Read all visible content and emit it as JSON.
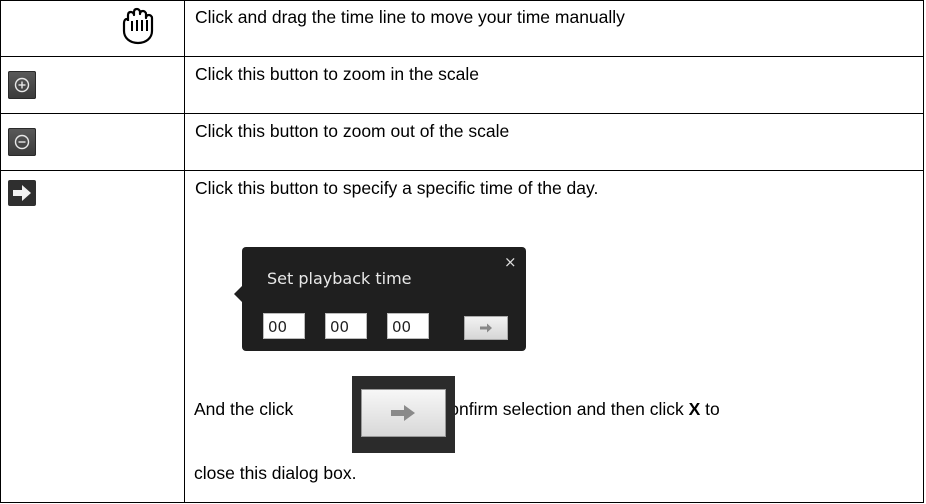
{
  "rows": [
    {
      "icon": "hand-grab-icon",
      "description": "Click and drag the time line to move your time manually"
    },
    {
      "icon": "zoom-in-icon",
      "description": "Click this button to zoom in the scale"
    },
    {
      "icon": "zoom-out-icon",
      "description": "Click this button to zoom out of the scale"
    },
    {
      "icon": "arrow-right-icon",
      "description": "Click this button to specify a specific time of the day.",
      "dialog": {
        "title": "Set playback time",
        "close_label": "×",
        "hours": "00",
        "minutes": "00",
        "seconds": "00",
        "go_icon": "arrow-right-icon"
      },
      "confirm_before": "And the click",
      "confirm_after": "to confirm selection and then click",
      "confirm_bold": "X",
      "confirm_to": "to",
      "confirm_line2": "close this dialog box."
    }
  ],
  "colors": {
    "button_dark": "#3a3a3a",
    "popup_bg": "#1f1f1f"
  }
}
